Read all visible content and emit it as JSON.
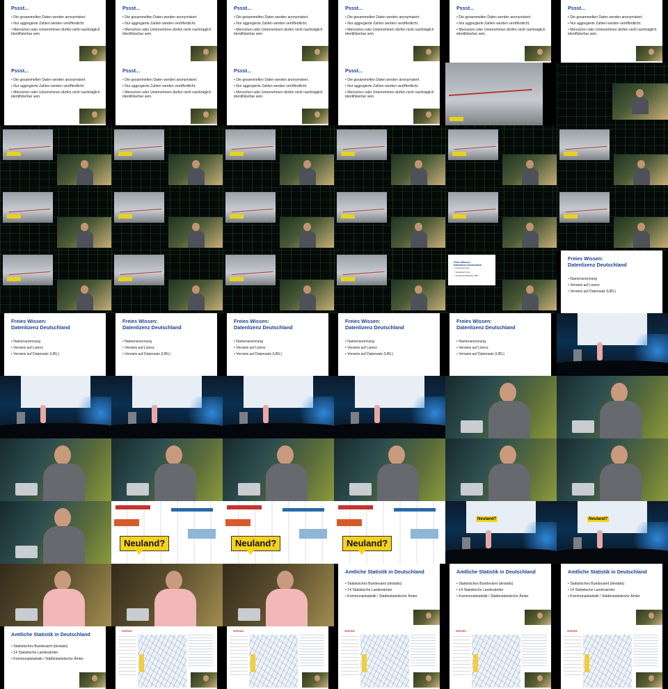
{
  "slides": {
    "pssst": {
      "title": "Pssst...",
      "bullets": [
        "Die gesammelten Daten werden anonymisiert.",
        "Nur aggregierte Zahlen werden veröffentlicht.",
        "Menschen oder Unternehmen dürfen nicht nachträglich identifizierbar sein."
      ]
    },
    "graffiti": {
      "text": "Volkszählung? NEIN!"
    },
    "freies_wissen": {
      "title_line1": "Freies Wissen:",
      "title_line2": "Datenlizenz Deutschland",
      "bullets": [
        "Namensnennung",
        "Verweis auf Lizenz",
        "Verweis auf Datensatz (URL)"
      ]
    },
    "neuland": {
      "label": "Neuland?"
    },
    "amtliche_statistik": {
      "title": "Amtliche Statistik in Deutschland",
      "bullets": [
        "Statistisches Bundesamt (destatis)",
        "14 Statistische Landesämter",
        "Kommunalstatistik / Städtestatistische Ämter"
      ]
    },
    "map": {
      "logo": "zensus"
    }
  },
  "grid": {
    "columns": 6,
    "rows": 11
  },
  "tiles": [
    "pssst",
    "pssst",
    "pssst",
    "pssst",
    "pssst",
    "pssst",
    "pssst",
    "pssst",
    "pssst",
    "pssst",
    "graffiti_full",
    "speaker_stage",
    "graffiti_stage",
    "graffiti_stage",
    "graffiti_stage",
    "graffiti_stage",
    "graffiti_stage",
    "graffiti_stage",
    "graffiti_stage",
    "graffiti_stage",
    "graffiti_stage",
    "graffiti_stage",
    "graffiti_stage",
    "graffiti_stage",
    "graffiti_stage",
    "graffiti_stage",
    "graffiti_stage",
    "graffiti_stage",
    "freies_wissen_tiny",
    "freies_wissen",
    "freies_wissen",
    "freies_wissen",
    "freies_wissen",
    "freies_wissen",
    "freies_wissen",
    "hall_freies",
    "hall_freies",
    "hall_freies",
    "hall_freies",
    "hall_freies",
    "closeup",
    "closeup",
    "closeup",
    "closeup",
    "closeup",
    "closeup",
    "closeup",
    "closeup",
    "closeup",
    "neuland",
    "neuland",
    "neuland",
    "hall_neuland",
    "hall_neuland",
    "closeup_female",
    "closeup_female",
    "closeup_female",
    "amtliche",
    "amtliche",
    "amtliche",
    "amtliche",
    "map",
    "map",
    "map",
    "map",
    "map"
  ]
}
